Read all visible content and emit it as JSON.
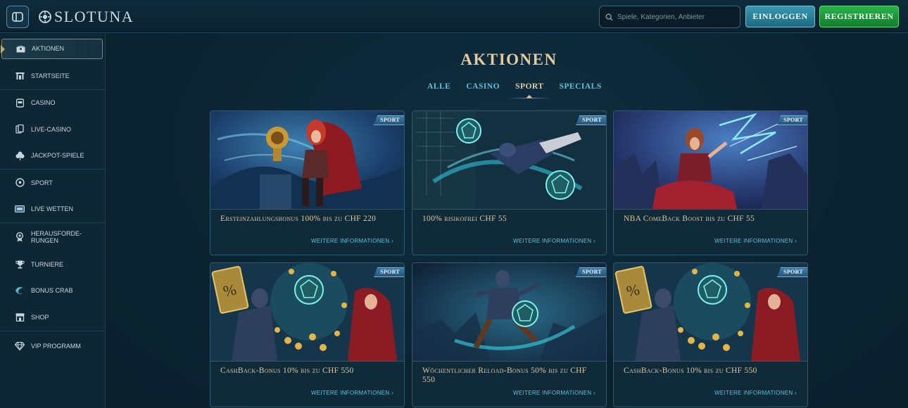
{
  "header": {
    "logo_text": "SLOTUNA",
    "search_placeholder": "Spiele, Kategorien, Anbieter",
    "login_label": "EINLOGGEN",
    "register_label": "REGISTRIEREN"
  },
  "sidebar": {
    "items": [
      {
        "label": "AKTIONEN",
        "icon": "chest-icon"
      },
      {
        "label": "STARTSEITE",
        "icon": "home-icon"
      },
      {
        "label": "CASINO",
        "icon": "slot-machine-icon"
      },
      {
        "label": "LIVE-CASINO",
        "icon": "cards-icon"
      },
      {
        "label": "JACKPOT-SPIELE",
        "icon": "clover-icon"
      },
      {
        "label": "SPORT",
        "icon": "ball-icon"
      },
      {
        "label": "LIVE WETTEN",
        "icon": "live-icon"
      },
      {
        "label": "HERAUSFORDE-",
        "label2": "RUNGEN",
        "icon": "medal-icon"
      },
      {
        "label": "TURNIERE",
        "icon": "trophy-icon"
      },
      {
        "label": "BONUS CRAB",
        "icon": "crab-icon"
      },
      {
        "label": "SHOP",
        "icon": "shop-icon"
      },
      {
        "label": "VIP PROGRAMM",
        "icon": "diamond-icon"
      }
    ]
  },
  "main": {
    "title": "AKTIONEN",
    "tabs": [
      {
        "label": "ALLE",
        "active": false
      },
      {
        "label": "CASINO",
        "active": false
      },
      {
        "label": "SPORT",
        "active": true
      },
      {
        "label": "SPECIALS",
        "active": false
      }
    ],
    "cards": [
      {
        "badge": "SPORT",
        "title": "Ersteinzahlungsbonus 100% bis zu CHF 220",
        "more": "WEITERE INFORMATIONEN"
      },
      {
        "badge": "SPORT",
        "title": "100% risikofrei CHF 55",
        "more": "WEITERE INFORMATIONEN"
      },
      {
        "badge": "SPORT",
        "title": "NBA ComeBack Boost bis zu CHF 55",
        "more": "WEITERE INFORMATIONEN"
      },
      {
        "badge": "SPORT",
        "title": "CashBack-Bonus 10% bis zu CHF 550",
        "more": "WEITERE INFORMATIONEN"
      },
      {
        "badge": "SPORT",
        "title": "Wöchentlicher Reload-Bonus 50% bis zu CHF 550",
        "more": "WEITERE INFORMATIONEN"
      },
      {
        "badge": "SPORT",
        "title": "CashBack-Bonus 10% bis zu CHF 550",
        "more": "WEITERE INFORMATIONEN"
      }
    ]
  },
  "colors": {
    "accent_gold": "#e2cba1",
    "accent_cyan": "#5bc3dc",
    "register_green": "#1f9a3e",
    "login_teal": "#2a84a0"
  }
}
